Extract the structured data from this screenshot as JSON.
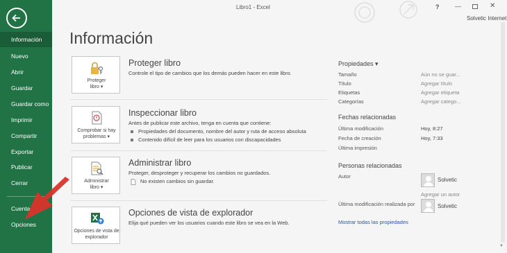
{
  "window": {
    "title": "Libro1 - Excel",
    "help_label": "?",
    "minimize_label": "—",
    "close_label": "✕",
    "account": "Solvetic Internet"
  },
  "sidebar": {
    "items": [
      {
        "label": "Información",
        "active": true
      },
      {
        "label": "Nuevo"
      },
      {
        "label": "Abrir"
      },
      {
        "label": "Guardar"
      },
      {
        "label": "Guardar como"
      },
      {
        "label": "Imprimir"
      },
      {
        "label": "Compartir"
      },
      {
        "label": "Exportar"
      },
      {
        "label": "Publicar"
      },
      {
        "label": "Cerrar"
      },
      {
        "label": "Cuenta"
      },
      {
        "label": "Opciones"
      }
    ]
  },
  "page": {
    "title": "Información"
  },
  "cards": {
    "protect": {
      "button_line1": "Proteger",
      "button_line2": "libro ▾",
      "title": "Proteger libro",
      "desc": "Controle el tipo de cambios que los demás pueden hacer en este libro."
    },
    "inspect": {
      "button_line1": "Comprobar si hay",
      "button_line2": "problemas ▾",
      "title": "Inspeccionar libro",
      "desc": "Antes de publicar este archivo, tenga en cuenta que contiene:",
      "bullets": [
        "Propiedades del documento, nombre del autor y ruta de acceso absoluta",
        "Contenido difícil de leer para los usuarios con discapacidades"
      ]
    },
    "manage": {
      "button_line1": "Administrar",
      "button_line2": "libro ▾",
      "title": "Administrar libro",
      "desc": "Proteger, desproteger y recuperar los cambios no guardados.",
      "note": "No existen cambios sin guardar."
    },
    "browser": {
      "button_line1": "Opciones de vista de",
      "button_line2": "explorador",
      "title": "Opciones de vista de explorador",
      "desc": "Elija qué pueden ver los usuarios cuando este libro se vea en la Web."
    }
  },
  "properties": {
    "heading": "Propiedades ▾",
    "rows": [
      {
        "label": "Tamaño",
        "value": "Aún no se guar..."
      },
      {
        "label": "Título",
        "value": "Agregar título"
      },
      {
        "label": "Etiquetas",
        "value": "Agregar etiqueta"
      },
      {
        "label": "Categorías",
        "value": "Agregar catego..."
      }
    ],
    "dates_heading": "Fechas relacionadas",
    "dates": [
      {
        "label": "Última modificación",
        "value": "Hoy, 8:27"
      },
      {
        "label": "Fecha de creación",
        "value": "Hoy, 7:33"
      },
      {
        "label": "Última impresión",
        "value": ""
      }
    ],
    "people_heading": "Personas relacionadas",
    "author_label": "Autor",
    "author_name": "Solvetic",
    "add_author": "Agregar un autor",
    "modified_by_label": "Última modificación realizada por",
    "modified_by_name": "Solvetic",
    "show_all": "Mostrar todas las propiedades"
  },
  "colors": {
    "sidebar": "#217346",
    "sidebar_active": "#1a5c38",
    "link": "#2b5797",
    "annotation_arrow": "#d9342b"
  },
  "icons": [
    "back-arrow-icon",
    "lock-key-icon",
    "inspect-document-icon",
    "manage-document-icon",
    "excel-web-icon",
    "user-avatar-icon"
  ]
}
